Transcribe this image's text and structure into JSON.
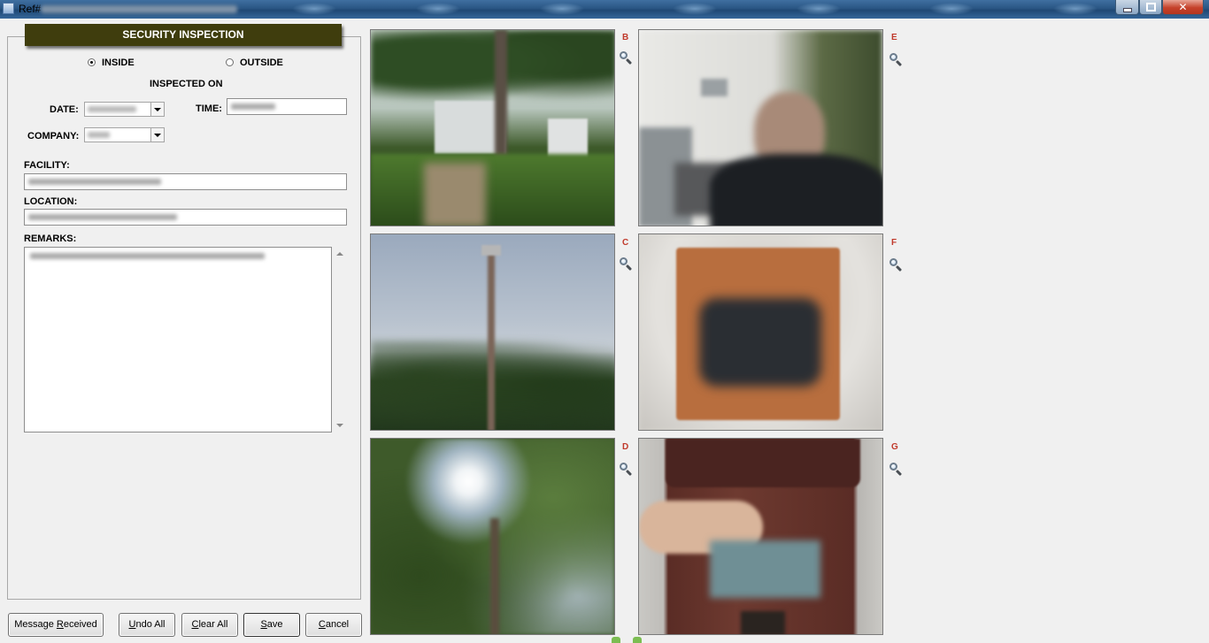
{
  "window": {
    "title": "Ref#"
  },
  "form": {
    "header": "SECURITY INSPECTION",
    "radio_inside": "INSIDE",
    "radio_outside": "OUTSIDE",
    "selected_scope": "INSIDE",
    "inspected_on": "INSPECTED ON",
    "date_label": "DATE:",
    "time_label": "TIME:",
    "company_label": "COMPANY:",
    "facility_label": "FACILITY:",
    "location_label": "LOCATION:",
    "remarks_label": "REMARKS:"
  },
  "buttons": {
    "message_received": {
      "pre": "Message ",
      "key": "R",
      "post": "eceived"
    },
    "undo_all": {
      "pre": "",
      "key": "U",
      "post": "ndo All"
    },
    "clear_all": {
      "pre": "",
      "key": "C",
      "post": "lear All"
    },
    "save": {
      "pre": "",
      "key": "S",
      "post": "ave"
    },
    "cancel": {
      "pre": "",
      "key": "C",
      "post": "ancel"
    }
  },
  "photos": [
    {
      "label": "B",
      "subject": "fenced-yard-with-tower-base"
    },
    {
      "label": "C",
      "subject": "communication-tower"
    },
    {
      "label": "D",
      "subject": "tree-with-sunlight"
    },
    {
      "label": "E",
      "subject": "man-at-door"
    },
    {
      "label": "F",
      "subject": "wall-sensor"
    },
    {
      "label": "G",
      "subject": "meter-box-hand"
    }
  ],
  "icons": {
    "zoom": "magnifier-icon",
    "window_minimize": "minimize-icon",
    "window_maximize": "maximize-icon",
    "window_close": "close-icon"
  }
}
